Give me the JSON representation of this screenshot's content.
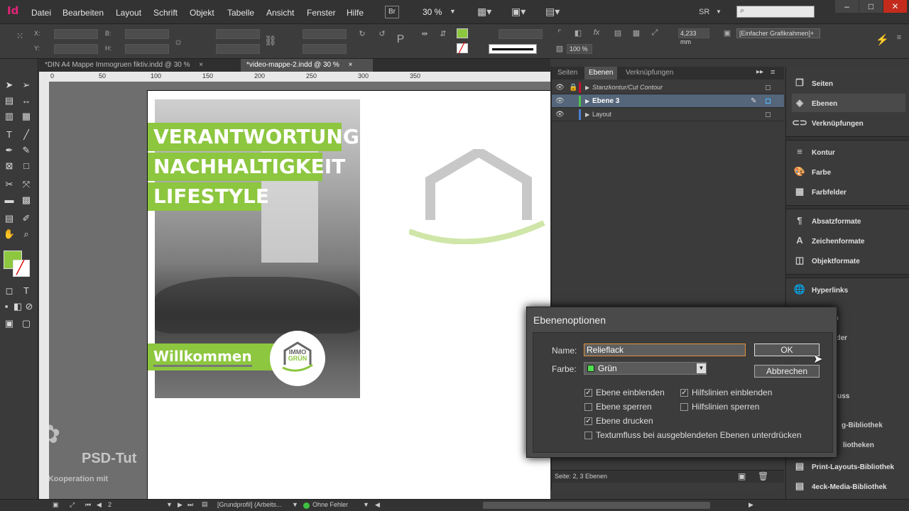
{
  "app": {
    "logo": "Id"
  },
  "menu": [
    "Datei",
    "Bearbeiten",
    "Layout",
    "Schrift",
    "Objekt",
    "Tabelle",
    "Ansicht",
    "Fenster",
    "Hilfe"
  ],
  "menubar": {
    "bridge": "Br",
    "zoom": "30 %",
    "user": "SR",
    "search_placeholder": ""
  },
  "control": {
    "x_label": "X:",
    "y_label": "Y:",
    "b_label": "B:",
    "h_label": "H:",
    "stroke_weight": "4,233 mm",
    "frame_style": "[Einfacher Grafikrahmen]+",
    "opacity": "100 %"
  },
  "tabs": [
    {
      "label": "*DIN A4 Mappe Immogruen fiktiv.indd @ 30 %",
      "close": "×"
    },
    {
      "label": "*video-mappe-2.indd @ 30 %",
      "close": "×"
    }
  ],
  "ruler": {
    "h": [
      "0",
      "50",
      "100",
      "150",
      "200",
      "250",
      "300",
      "350"
    ]
  },
  "document": {
    "headline": [
      "VERANTWORTUNG",
      "NACHHALTIGKEIT",
      "LIFESTYLE"
    ],
    "welcome": "Willkommen",
    "logo_text": [
      "IMMO",
      "GRÜN"
    ]
  },
  "watermark": {
    "brand": "PSD-Tut",
    "coop": "in Kooperation mit"
  },
  "layers_panel": {
    "tabs": [
      "Seiten",
      "Ebenen",
      "Verknüpfungen"
    ],
    "layers": [
      {
        "name": "Stanzkontur/Cut Contour",
        "color": "#c8102e"
      },
      {
        "name": "Ebene 3",
        "color": "#4fc34f"
      },
      {
        "name": "Layout",
        "color": "#4a7fd4"
      }
    ],
    "status": "Seite: 2, 3 Ebenen"
  },
  "right_panel": {
    "groups": [
      [
        {
          "label": "Seiten",
          "icon": "pages-icon"
        },
        {
          "label": "Ebenen",
          "icon": "layers-icon"
        },
        {
          "label": "Verknüpfungen",
          "icon": "links-icon"
        }
      ],
      [
        {
          "label": "Kontur",
          "icon": "stroke-icon"
        },
        {
          "label": "Farbe",
          "icon": "color-icon"
        },
        {
          "label": "Farbfelder",
          "icon": "swatches-icon"
        }
      ],
      [
        {
          "label": "Absatzformate",
          "icon": "paragraph-styles-icon"
        },
        {
          "label": "Zeichenformate",
          "icon": "character-styles-icon"
        },
        {
          "label": "Objektformate",
          "icon": "object-styles-icon"
        }
      ],
      [
        {
          "label": "Hyperlinks",
          "icon": "hyperlinks-icon"
        }
      ]
    ],
    "hidden_partials": [
      "iten",
      "elder",
      "fluss",
      "g-Bibliothek",
      "liotheken"
    ],
    "bottom": [
      {
        "label": "Print-Layouts-Bibliothek",
        "icon": "library-icon"
      },
      {
        "label": "4eck-Media-Bibliothek",
        "icon": "library-icon"
      }
    ]
  },
  "dialog": {
    "title": "Ebenenoptionen",
    "name_label": "Name:",
    "name_value": "Relieflack",
    "color_label": "Farbe:",
    "color_value": "Grün",
    "color_swatch": "#4fe04f",
    "ok": "OK",
    "cancel": "Abbrechen",
    "options": [
      {
        "label": "Ebene einblenden",
        "checked": true
      },
      {
        "label": "Hilfslinien einblenden",
        "checked": true
      },
      {
        "label": "Ebene sperren",
        "checked": false
      },
      {
        "label": "Hilfslinien sperren",
        "checked": false
      },
      {
        "label": "Ebene drucken",
        "checked": true
      },
      {
        "label": "Textumfluss bei ausgeblendeten Ebenen unterdrücken",
        "checked": false
      }
    ]
  },
  "statusbar": {
    "page": "2",
    "profile": "[Grundprofil] (Arbeits...",
    "errors": "Ohne Fehler"
  },
  "colors": {
    "accent_green": "#8dc63f",
    "fill": "#8dc63f"
  }
}
